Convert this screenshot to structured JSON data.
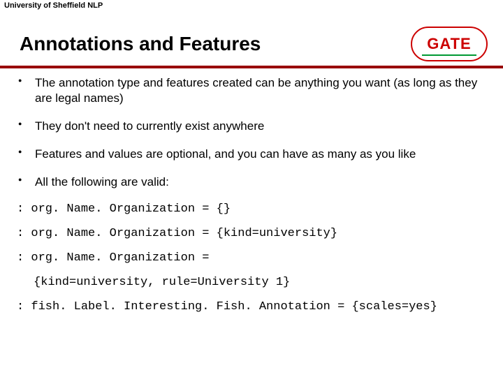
{
  "header": {
    "affiliation": "University of Sheffield NLP"
  },
  "logo": {
    "text": "GATE"
  },
  "slide": {
    "title": "Annotations and Features"
  },
  "bullets": [
    "The annotation type and features created can be anything you want (as long as they are legal names)",
    "They don't need to currently exist anywhere",
    "Features and values are optional, and you can have as many as you like",
    "All the following are valid:"
  ],
  "code": {
    "line1": ": org. Name. Organization = {}",
    "line2": ": org. Name. Organization = {kind=university}",
    "line3": ": org. Name. Organization =",
    "line4": "{kind=university, rule=University 1}",
    "line5": ": fish. Label. Interesting. Fish. Annotation = {scales=yes}"
  }
}
